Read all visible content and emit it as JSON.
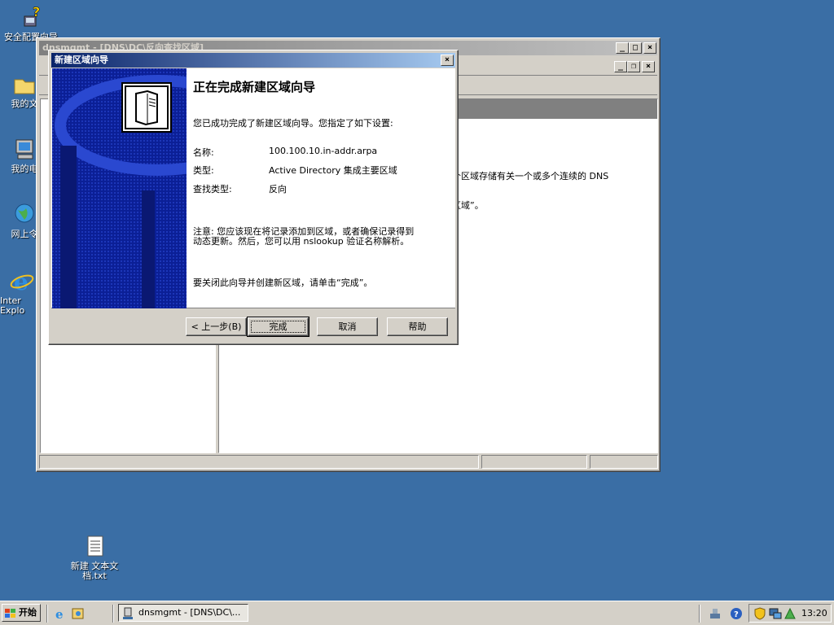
{
  "desktop": {
    "icons": [
      {
        "label": "安全配置向导",
        "name": "security-config-wizard-icon"
      },
      {
        "label": "我的文",
        "name": "my-documents-icon"
      },
      {
        "label": "我的电",
        "name": "my-computer-icon"
      },
      {
        "label": "网上令",
        "name": "network-places-icon"
      },
      {
        "label": "Inter Explo",
        "name": "internet-explorer-icon"
      },
      {
        "label": "新建 文本文档.txt",
        "name": "text-file-icon"
      }
    ]
  },
  "mmc": {
    "title": "dnsmgmt - [DNS\\DC\\反向查找区域]",
    "right_text_1": "个区域存储有关一个或多个连续的 DNS",
    "right_text_2": "区域”。"
  },
  "wizard": {
    "title": "新建区域向导",
    "heading": "正在完成新建区域向导",
    "intro": "您已成功完成了新建区域向导。您指定了如下设置:",
    "rows": [
      {
        "label": "名称:",
        "value": "100.100.10.in-addr.arpa"
      },
      {
        "label": "类型:",
        "value": "Active Directory 集成主要区域"
      },
      {
        "label": "查找类型:",
        "value": "反向"
      }
    ],
    "note": "注意: 您应该现在将记录添加到区域，或者确保记录得到动态更新。然后，您可以用 nslookup 验证名称解析。",
    "closing": "要关闭此向导并创建新区域，请单击“完成”。",
    "buttons": {
      "back": "< 上一步(B)",
      "finish": "完成",
      "cancel": "取消",
      "help": "帮助"
    }
  },
  "taskbar": {
    "start_label": "开始",
    "task_label": "dnsmgmt - [DNS\\DC\\...",
    "clock": "13:20"
  }
}
